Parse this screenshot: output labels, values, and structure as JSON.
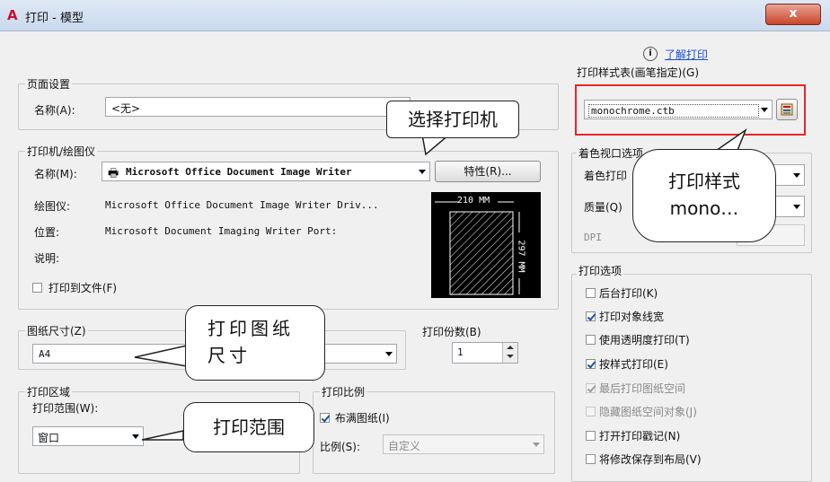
{
  "window": {
    "title": "打印 - 模型",
    "close_glyph": "x",
    "app_icon_letter": "A"
  },
  "help": {
    "link": "了解打印"
  },
  "page_setup": {
    "group_label": "页面设置",
    "name_label": "名称(A):",
    "name_value": "<无>"
  },
  "printer": {
    "group_label": "打印机/绘图仪",
    "name_label": "名称(M):",
    "name_value": "Microsoft Office Document Image Writer",
    "properties_button": "特性(R)...",
    "plotter_label": "绘图仪:",
    "plotter_value": "Microsoft Office Document Image Writer Driv...",
    "location_label": "位置:",
    "location_value": "Microsoft Document Imaging Writer Port:",
    "description_label": "说明:",
    "print_to_file": "打印到文件(F)",
    "preview_width": "210 MM",
    "preview_height": "297 MM"
  },
  "paper_size": {
    "group_label": "图纸尺寸(Z)",
    "value": "A4"
  },
  "copies": {
    "label": "打印份数(B)",
    "value": "1"
  },
  "plot_area": {
    "group_label": "打印区域",
    "range_label": "打印范围(W):",
    "range_value": "窗口"
  },
  "plot_scale": {
    "group_label": "打印比例",
    "fit_paper": "布满图纸(I)",
    "scale_label": "比例(S):",
    "scale_value": "自定义"
  },
  "plot_style_table": {
    "group_label": "打印样式表(画笔指定)(G)",
    "value": "monochrome.ctb"
  },
  "shaded_viewport": {
    "group_label": "着色视口选项",
    "shade_label": "着色打印",
    "quality_label": "质量(Q)",
    "dpi_label": "DPI"
  },
  "plot_options": {
    "group_label": "打印选项",
    "items": [
      {
        "label": "后台打印(K)",
        "checked": false,
        "disabled": false
      },
      {
        "label": "打印对象线宽",
        "checked": true,
        "disabled": false
      },
      {
        "label": "使用透明度打印(T)",
        "checked": false,
        "disabled": false
      },
      {
        "label": "按样式打印(E)",
        "checked": true,
        "disabled": false
      },
      {
        "label": "最后打印图纸空间",
        "checked": true,
        "disabled": true
      },
      {
        "label": "隐藏图纸空间对象(J)",
        "checked": false,
        "disabled": true
      },
      {
        "label": "打开打印戳记(N)",
        "checked": false,
        "disabled": false
      },
      {
        "label": "将修改保存到布局(V)",
        "checked": false,
        "disabled": false
      }
    ]
  },
  "callouts": {
    "printer": "选择打印机",
    "style": [
      "打印样式",
      "mono…"
    ],
    "paper": [
      "打印图纸",
      "尺寸"
    ],
    "range": "打印范围"
  },
  "colors": {
    "highlight": "#e8262a",
    "link": "#1a4fd6"
  }
}
